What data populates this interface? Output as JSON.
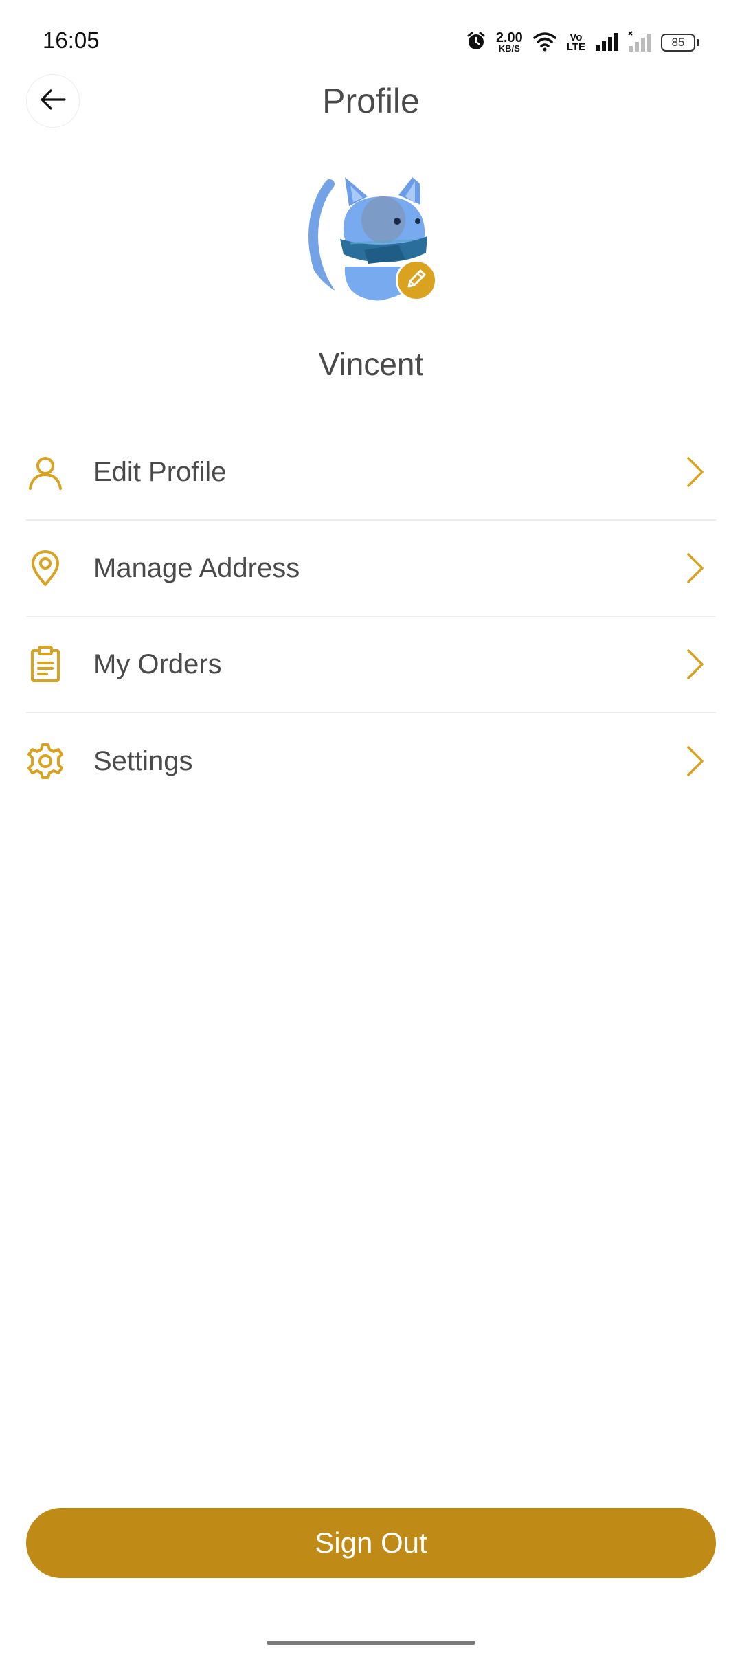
{
  "status_bar": {
    "time": "16:05",
    "net_speed_value": "2.00",
    "net_speed_unit": "KB/S",
    "volte_top": "Vo",
    "volte_bottom": "LTE",
    "battery": "85"
  },
  "header": {
    "title": "Profile",
    "back_icon": "arrow-left-icon"
  },
  "profile": {
    "name": "Vincent",
    "avatar": "blue-cat-with-scarf",
    "edit_icon": "pencil-icon"
  },
  "menu": {
    "items": [
      {
        "label": "Edit Profile",
        "icon": "user-icon"
      },
      {
        "label": "Manage Address",
        "icon": "location-pin-icon"
      },
      {
        "label": "My Orders",
        "icon": "clipboard-icon"
      },
      {
        "label": "Settings",
        "icon": "gear-icon"
      }
    ]
  },
  "footer": {
    "sign_out_label": "Sign Out"
  },
  "colors": {
    "accent": "#d9a21f",
    "button": "#bf8a16",
    "text": "#4a4a4a",
    "divider": "#ececec"
  }
}
